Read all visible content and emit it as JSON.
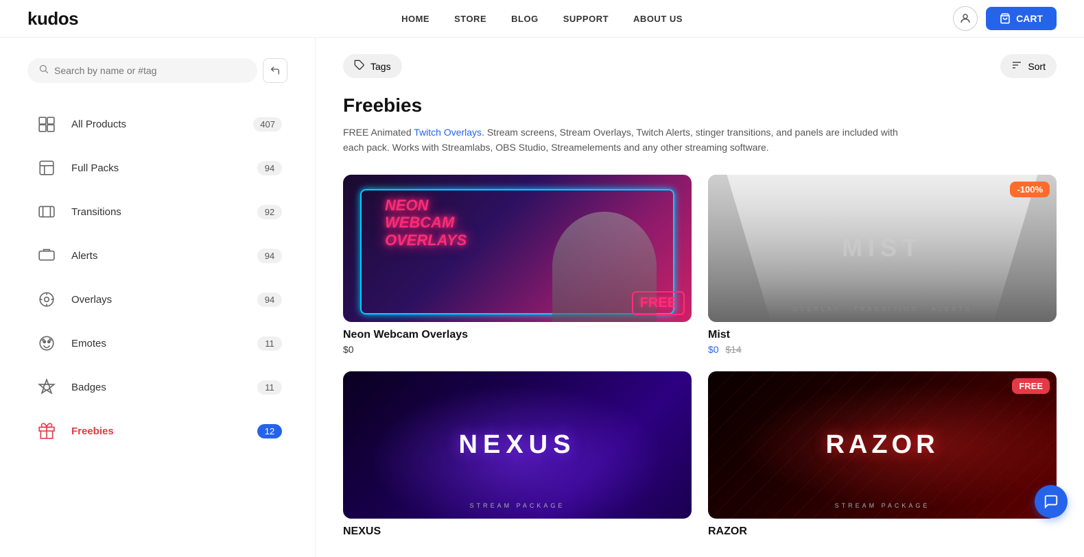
{
  "header": {
    "logo": "kudos",
    "nav": [
      {
        "label": "HOME"
      },
      {
        "label": "STORE"
      },
      {
        "label": "BLOG"
      },
      {
        "label": "SUPPORT"
      },
      {
        "label": "ABOUT US"
      }
    ],
    "cart_label": "CART"
  },
  "sidebar": {
    "search_placeholder": "Search by name or #tag",
    "categories": [
      {
        "id": "all-products",
        "label": "All Products",
        "count": "407",
        "active": false
      },
      {
        "id": "full-packs",
        "label": "Full Packs",
        "count": "94",
        "active": false
      },
      {
        "id": "transitions",
        "label": "Transitions",
        "count": "92",
        "active": false
      },
      {
        "id": "alerts",
        "label": "Alerts",
        "count": "94",
        "active": false
      },
      {
        "id": "overlays",
        "label": "Overlays",
        "count": "94",
        "active": false
      },
      {
        "id": "emotes",
        "label": "Emotes",
        "count": "11",
        "active": false
      },
      {
        "id": "badges",
        "label": "Badges",
        "count": "11",
        "active": false
      },
      {
        "id": "freebies",
        "label": "Freebies",
        "count": "12",
        "active": true
      }
    ]
  },
  "toolbar": {
    "tags_label": "Tags",
    "sort_label": "Sort"
  },
  "section": {
    "title": "Freebies",
    "description_part1": "FREE Animated ",
    "description_link": "Twitch Overlays",
    "description_part2": ". Stream screens, Stream Overlays, Twitch Alerts, stinger transitions, and panels are included with each pack. Works with Streamlabs, OBS Studio, Streamelements and any other streaming software."
  },
  "products": [
    {
      "id": "neon-webcam",
      "name": "Neon Webcam Overlays",
      "price": "$0",
      "original_price": null,
      "badge": null,
      "type": "neon"
    },
    {
      "id": "mist",
      "name": "Mist",
      "price": "$0",
      "original_price": "$14",
      "badge": "-100%",
      "type": "mist"
    },
    {
      "id": "nexus",
      "name": "NEXUS",
      "price": null,
      "original_price": null,
      "badge": null,
      "type": "nexus"
    },
    {
      "id": "razor",
      "name": "RAZOR",
      "price": null,
      "original_price": null,
      "badge": "FREE",
      "type": "razor"
    }
  ],
  "icons": {
    "search": "🔍",
    "back": "↩",
    "cart": "🛒",
    "user": "👤",
    "tag": "🏷",
    "sort": "≡",
    "chat": "💬"
  }
}
